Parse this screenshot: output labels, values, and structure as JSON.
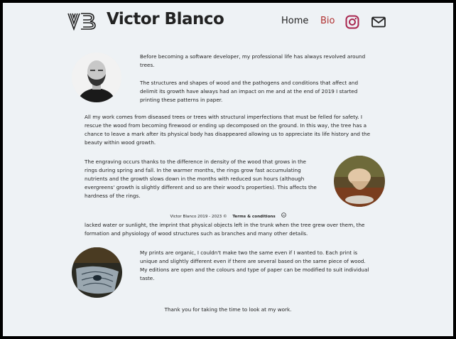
{
  "header": {
    "logo_mark": "VB",
    "brand": "Victor Blanco",
    "nav": {
      "home": "Home",
      "bio": "Bio"
    },
    "icons": [
      "instagram-icon",
      "mail-icon"
    ]
  },
  "bio": {
    "p1": "Before becoming a software developer, my professional life has always revolved around trees.",
    "p2": "The structures and shapes of wood and the pathogens and conditions that affect and delimit its growth have always had an impact on me and at the end of 2019 I started printing these patterns in paper.",
    "p3": "All my work comes from diseased trees or trees with structural imperfections that must be felled for safety. I rescue the wood from becoming firewood or ending up decomposed on the ground. In this way, the tree has a chance to leave a mark after its physical body has disappeared allowing us to appreciate its life history and the beauty within wood growth.",
    "p4": "The engraving occurs thanks to the difference in density of the wood that grows in the rings during spring and fall. In the warmer months, the rings grow fast accumulating nutrients and the growth slows down in the months with reduced sun hours (although evergreens' growth is slightly different and so are their wood's properties). This affects the hardness of the rings.",
    "p5": "lacked water or sunlight, the imprint that physical objects left in the trunk when the tree grew over them, the formation and physiology of wood structures such as branches and many other details.",
    "p6": "My prints are organic, I couldn't make two the same even if I wanted to. Each print is unique and slightly different even if there are several based on the same piece of wood. My editions are open and the colours and type of paper can be modified to suit individual taste.",
    "p7": "Thank you for taking the time to look at my work."
  },
  "footer": {
    "copyright": "Victor Blanco 2019 - 2023 ©",
    "terms": "Terms & conditions",
    "license_icon": "creative-commons-icon"
  },
  "colors": {
    "background": "#eef2f5",
    "text": "#222222",
    "accent": "#b03030",
    "frame": "#000000"
  }
}
